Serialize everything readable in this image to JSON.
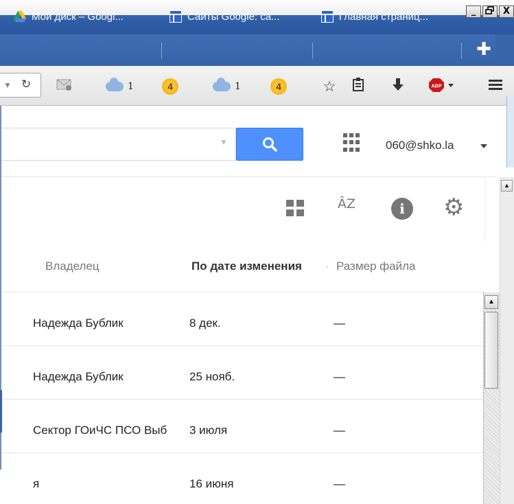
{
  "window": {
    "controls": [
      "_",
      "🗗",
      "X"
    ]
  },
  "tabs": [
    {
      "label": "Мой диск – Googl...",
      "icon": "google-drive-icon"
    },
    {
      "label": "Сайты Google: ca...",
      "icon": "google-sites-icon"
    },
    {
      "label": "Главная страниц...",
      "icon": "google-sites-icon"
    }
  ],
  "new_tab": "✚",
  "toolbar": {
    "items": [
      {
        "icon": "cloud-icon",
        "count": "1"
      },
      {
        "icon": "badge-4-icon",
        "badge": "4"
      },
      {
        "icon": "cloud-icon",
        "count": "1"
      },
      {
        "icon": "badge-4-icon",
        "badge": "4"
      }
    ],
    "abp_label": "ABP"
  },
  "header": {
    "account": "060@shko.la"
  },
  "columns": {
    "owner": "Владелец",
    "modified": "По дате изменения",
    "size": "Размер файла"
  },
  "rows": [
    {
      "owner": "Надежда Бублик",
      "date": "8 дек.",
      "size": "—"
    },
    {
      "owner": "Надежда Бублик",
      "date": "25 нояб.",
      "size": "—"
    },
    {
      "owner": "Сектор ГОиЧС ПСО Выб",
      "date": "3 июля",
      "size": "—"
    },
    {
      "owner": "я",
      "date": "16 июня",
      "size": "—"
    }
  ],
  "colors": {
    "accent": "#4d90fe",
    "titlebar": "#3763a8"
  }
}
